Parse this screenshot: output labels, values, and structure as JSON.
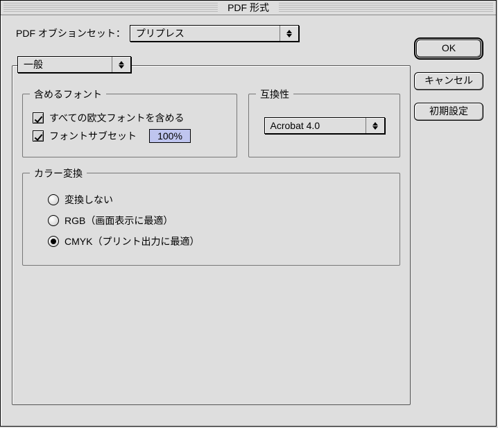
{
  "window": {
    "title": "PDF 形式"
  },
  "optset": {
    "label": "PDF オブションセット：",
    "value": "プリプレス"
  },
  "tabSelector": {
    "value": "一般"
  },
  "groups": {
    "fonts": {
      "legend": "含めるフォント",
      "includeAll": {
        "label": "すべての欧文フォントを含める",
        "checked": true
      },
      "subset": {
        "label": "フォントサブセット",
        "checked": true,
        "value": "100%"
      }
    },
    "compat": {
      "legend": "互換性",
      "value": "Acrobat 4.0"
    },
    "color": {
      "legend": "カラー変換",
      "options": [
        {
          "label": "変換しない",
          "selected": false
        },
        {
          "label": "RGB（画面表示に最適）",
          "selected": false
        },
        {
          "label": "CMYK（プリント出力に最適）",
          "selected": true
        }
      ]
    }
  },
  "buttons": {
    "ok": "OK",
    "cancel": "キャンセル",
    "defaults": "初期設定"
  }
}
